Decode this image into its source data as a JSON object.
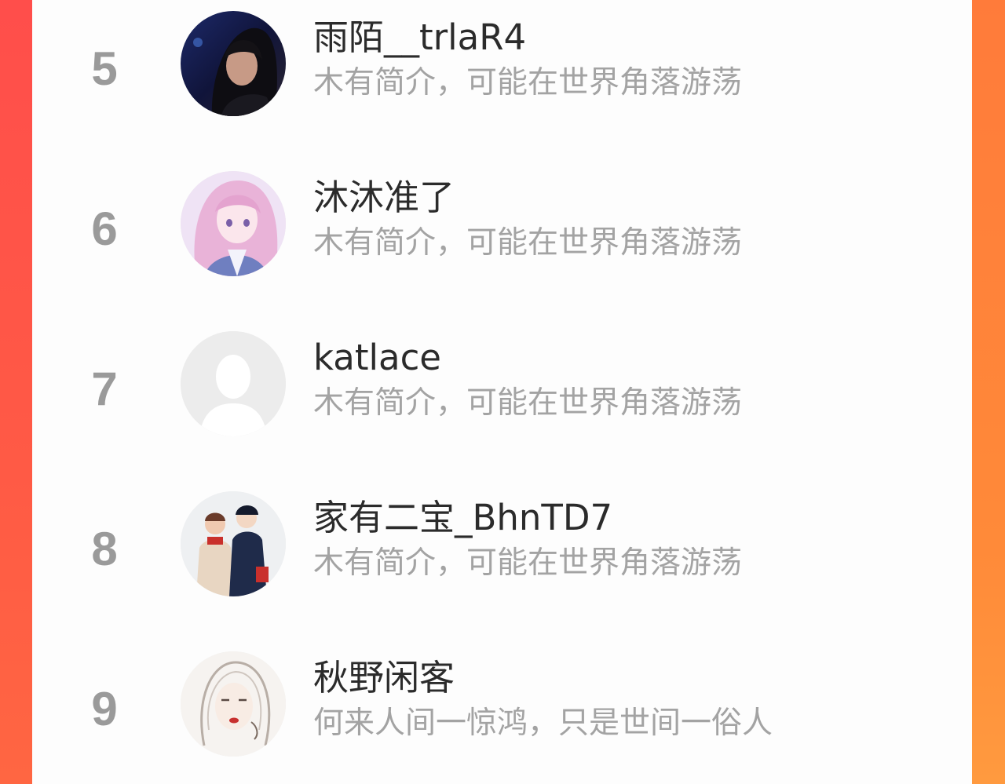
{
  "ranking": {
    "rows": [
      {
        "rank": "5",
        "name": "雨陌__trlaR4",
        "bio": "木有简介，可能在世界角落游荡",
        "avatar": "photo-avatar"
      },
      {
        "rank": "6",
        "name": "沐沐准了",
        "bio": "木有简介，可能在世界角落游荡",
        "avatar": "anime-girl-avatar"
      },
      {
        "rank": "7",
        "name": "katlace",
        "bio": "木有简介，可能在世界角落游荡",
        "avatar": "default-user-avatar"
      },
      {
        "rank": "8",
        "name": "家有二宝_BhnTD7",
        "bio": "木有简介，可能在世界角落游荡",
        "avatar": "illustrated-couple-avatar"
      },
      {
        "rank": "9",
        "name": "秋野闲客",
        "bio": "何来人间一惊鸿，只是世间一俗人",
        "avatar": "sketch-portrait-avatar"
      }
    ]
  },
  "colors": {
    "background_left": "#ff4d4a",
    "background_right": "#ff8a36",
    "panel": "#fdfdfd",
    "rank_text": "#9a9a9a",
    "name_text": "#2b2b2b",
    "bio_text": "#a3a3a3"
  }
}
